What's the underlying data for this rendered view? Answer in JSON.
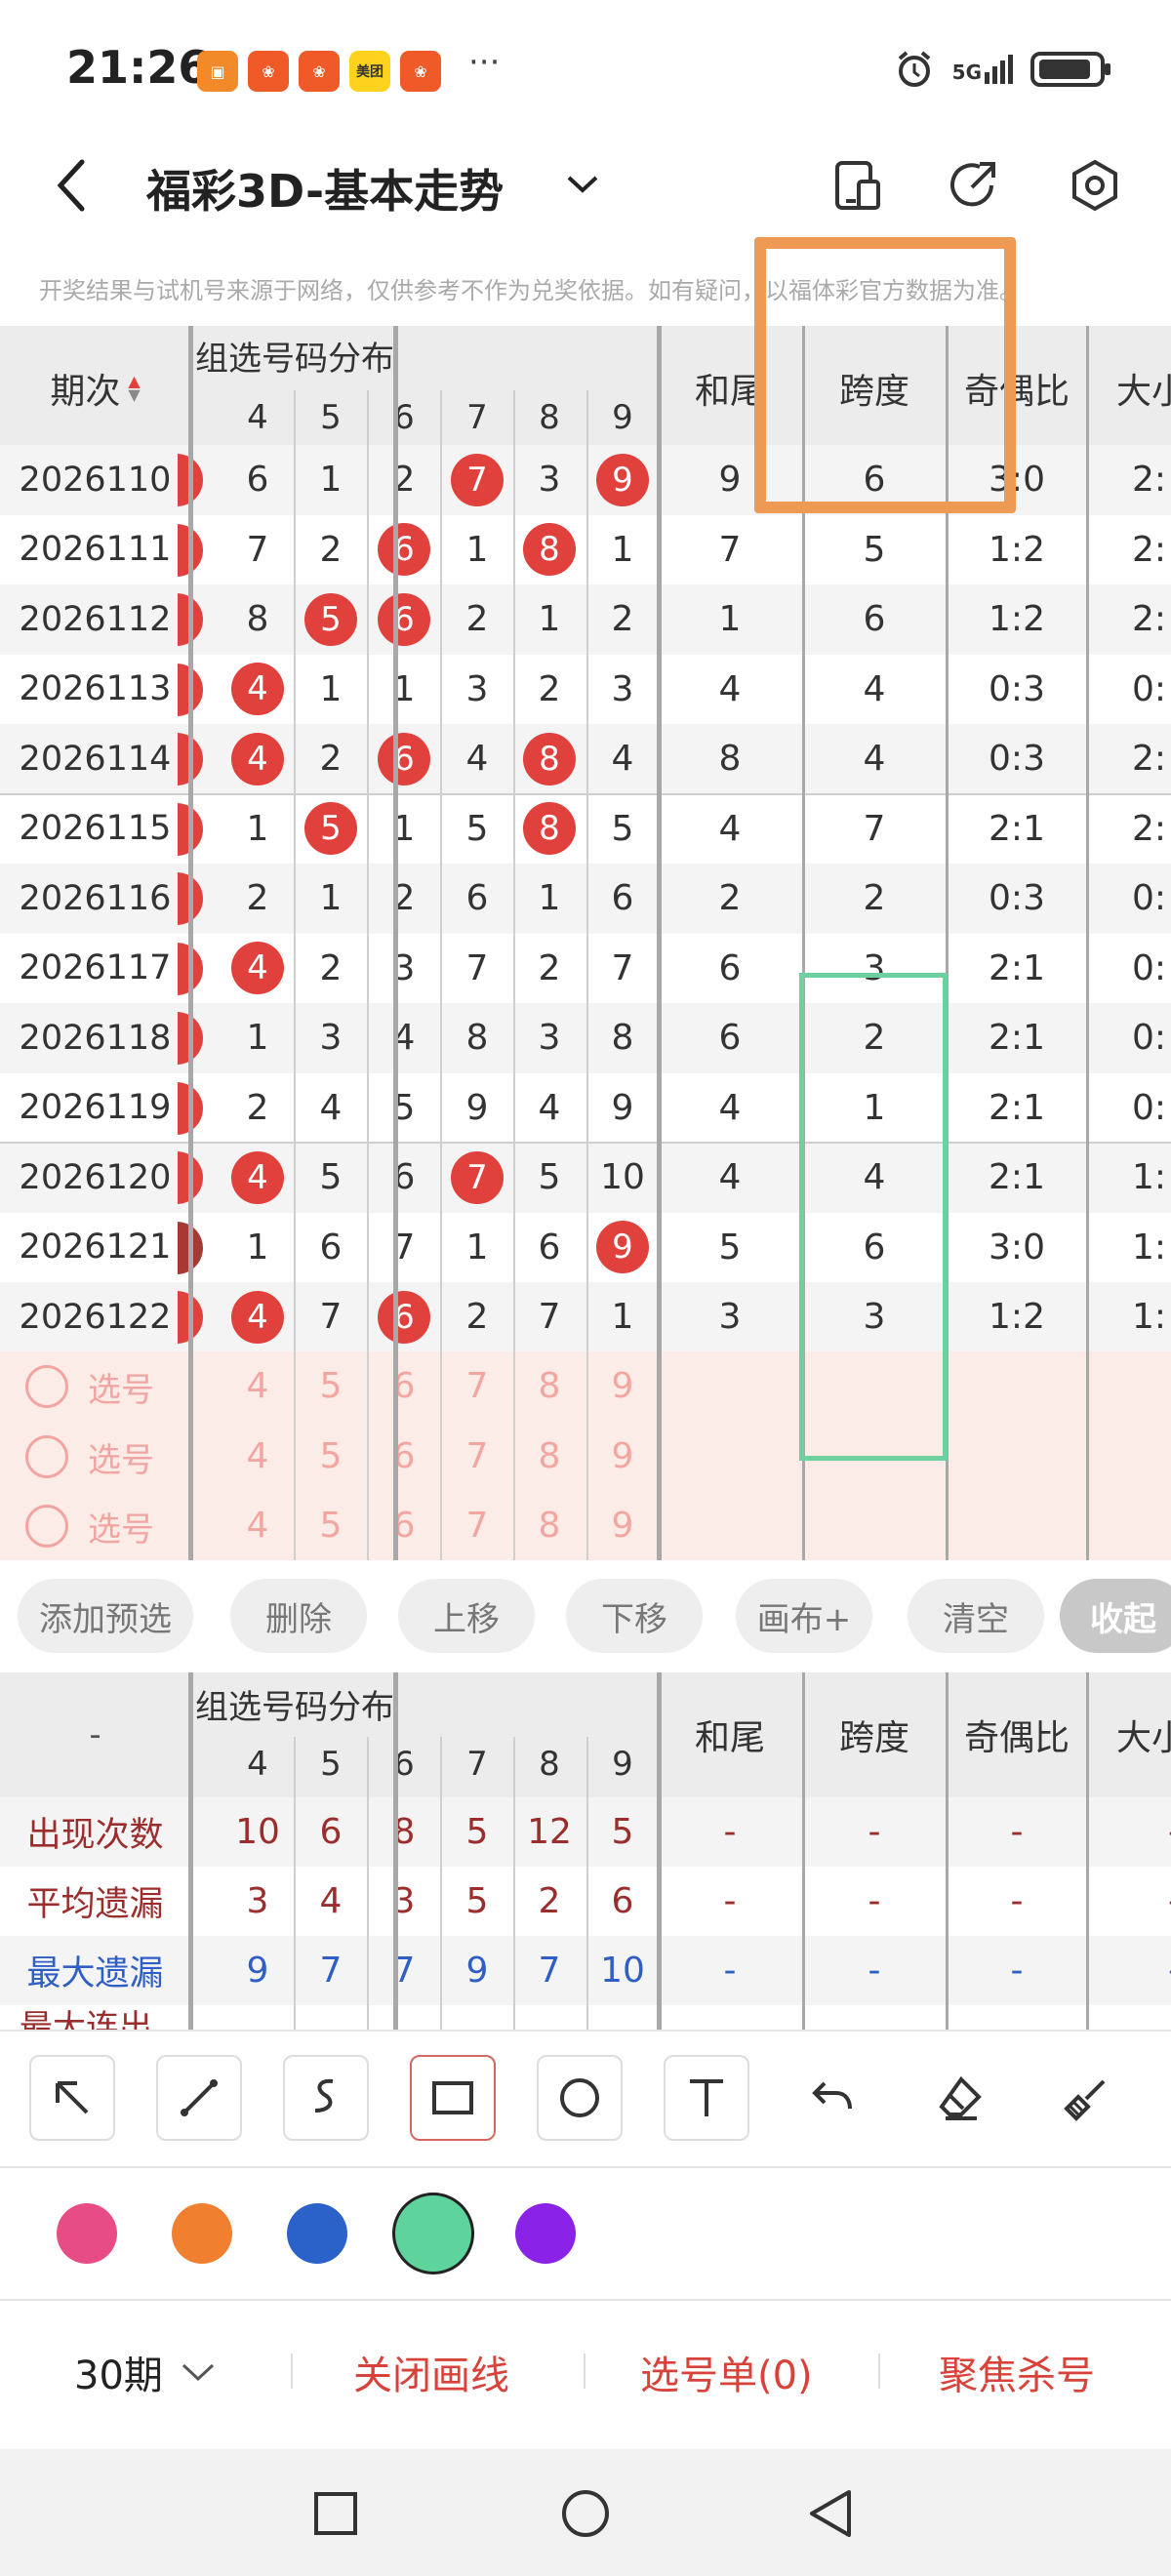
{
  "status_bar": {
    "time": "21:26",
    "app_icons": [
      "notif-icon",
      "app-icon",
      "app-icon",
      "美团",
      "app-icon"
    ],
    "more": "···",
    "network": "5G"
  },
  "header": {
    "title": "福彩3D-基本走势",
    "icons": [
      "back-icon",
      "chevron-down-icon",
      "phone-icon",
      "share-icon",
      "settings-icon"
    ]
  },
  "notice": "开奖结果与试机号来源于网络，仅供参考不作为兑奖依据。如有疑问，以福体彩官方数据为准。",
  "table": {
    "issue_header": "期次",
    "group_header": "组选号码分布",
    "digit_headers": [
      "4",
      "5",
      "6",
      "7",
      "8",
      "9"
    ],
    "stat_headers": [
      "和尾",
      "跨度",
      "奇偶比",
      "大小"
    ],
    "rows": [
      {
        "issue": "2026110",
        "digits": [
          "6",
          "1",
          "2",
          "7",
          "3",
          "9"
        ],
        "hit": [
          false,
          false,
          false,
          true,
          false,
          true
        ],
        "he": "9",
        "span": "6",
        "parity": "3:0",
        "size": "2:"
      },
      {
        "issue": "2026111",
        "digits": [
          "7",
          "2",
          "6",
          "1",
          "8",
          "1"
        ],
        "hit": [
          false,
          false,
          true,
          false,
          true,
          false
        ],
        "he": "7",
        "span": "5",
        "parity": "1:2",
        "size": "2:"
      },
      {
        "issue": "2026112",
        "digits": [
          "8",
          "5",
          "6",
          "2",
          "1",
          "2"
        ],
        "hit": [
          false,
          true,
          true,
          false,
          false,
          false
        ],
        "he": "1",
        "span": "6",
        "parity": "1:2",
        "size": "2:"
      },
      {
        "issue": "2026113",
        "digits": [
          "4",
          "1",
          "1",
          "3",
          "2",
          "3"
        ],
        "hit": [
          true,
          false,
          false,
          false,
          false,
          false
        ],
        "he": "4",
        "span": "4",
        "parity": "0:3",
        "size": "0:"
      },
      {
        "issue": "2026114",
        "digits": [
          "4",
          "2",
          "6",
          "4",
          "8",
          "4"
        ],
        "hit": [
          true,
          false,
          true,
          false,
          true,
          false
        ],
        "he": "8",
        "span": "4",
        "parity": "0:3",
        "size": "2:"
      },
      {
        "issue": "2026115",
        "digits": [
          "1",
          "5",
          "1",
          "5",
          "8",
          "5"
        ],
        "hit": [
          false,
          true,
          false,
          false,
          true,
          false
        ],
        "he": "4",
        "span": "7",
        "parity": "2:1",
        "size": "2:"
      },
      {
        "issue": "2026116",
        "digits": [
          "2",
          "1",
          "2",
          "6",
          "1",
          "6"
        ],
        "hit": [
          false,
          false,
          false,
          false,
          false,
          false
        ],
        "he": "2",
        "span": "2",
        "parity": "0:3",
        "size": "0:"
      },
      {
        "issue": "2026117",
        "digits": [
          "4",
          "2",
          "3",
          "7",
          "2",
          "7"
        ],
        "hit": [
          true,
          false,
          false,
          false,
          false,
          false
        ],
        "he": "6",
        "span": "3",
        "parity": "2:1",
        "size": "0:"
      },
      {
        "issue": "2026118",
        "digits": [
          "1",
          "3",
          "4",
          "8",
          "3",
          "8"
        ],
        "hit": [
          false,
          false,
          false,
          false,
          false,
          false
        ],
        "he": "6",
        "span": "2",
        "parity": "2:1",
        "size": "0:"
      },
      {
        "issue": "2026119",
        "digits": [
          "2",
          "4",
          "5",
          "9",
          "4",
          "9"
        ],
        "hit": [
          false,
          false,
          false,
          false,
          false,
          false
        ],
        "he": "4",
        "span": "1",
        "parity": "2:1",
        "size": "0:"
      },
      {
        "issue": "2026120",
        "digits": [
          "4",
          "5",
          "6",
          "7",
          "5",
          "10"
        ],
        "hit": [
          true,
          false,
          false,
          true,
          false,
          false
        ],
        "he": "4",
        "span": "4",
        "parity": "2:1",
        "size": "1:"
      },
      {
        "issue": "2026121",
        "digits": [
          "1",
          "6",
          "7",
          "1",
          "6",
          "9"
        ],
        "hit": [
          false,
          false,
          false,
          false,
          false,
          true
        ],
        "he": "5",
        "span": "6",
        "parity": "3:0",
        "size": "1:"
      },
      {
        "issue": "2026122",
        "digits": [
          "4",
          "7",
          "6",
          "2",
          "7",
          "1"
        ],
        "hit": [
          true,
          false,
          true,
          false,
          false,
          false
        ],
        "he": "3",
        "span": "3",
        "parity": "1:2",
        "size": "1:"
      }
    ],
    "pick_label": "选号",
    "pick_digits": [
      "4",
      "5",
      "6",
      "7",
      "8",
      "9"
    ]
  },
  "toolbar": [
    "添加预选",
    "删除",
    "上移",
    "下移",
    "画布+",
    "清空",
    "收起"
  ],
  "stats": {
    "dash": "-",
    "group_header": "组选号码分布",
    "digit_headers": [
      "4",
      "5",
      "6",
      "7",
      "8",
      "9"
    ],
    "stat_headers": [
      "和尾",
      "跨度",
      "奇偶比",
      "大小"
    ],
    "rows": [
      {
        "label": "出现次数",
        "values": [
          "10",
          "6",
          "8",
          "5",
          "12",
          "5"
        ],
        "color": "#9b2d2d"
      },
      {
        "label": "平均遗漏",
        "values": [
          "3",
          "4",
          "3",
          "5",
          "2",
          "6"
        ],
        "color": "#9b2d2d"
      },
      {
        "label": "最大遗漏",
        "values": [
          "9",
          "7",
          "7",
          "9",
          "7",
          "10"
        ],
        "color": "#2f5fc4"
      }
    ],
    "partial_label": "最大连出"
  },
  "drawing_tools": [
    "arrow-icon",
    "line-icon",
    "curve-icon",
    "rectangle-icon",
    "circle-icon",
    "text-icon",
    "undo-icon",
    "eraser-icon",
    "brush-icon"
  ],
  "palette": [
    "#e74d84",
    "#f08030",
    "#2a62c9",
    "#5fd39c",
    "#8a22e8"
  ],
  "bottom": {
    "period": "30期",
    "close_lines": "关闭画线",
    "pick_list": "选号单(0)",
    "focus_kill": "聚焦杀号"
  },
  "accent": "#e0413c"
}
